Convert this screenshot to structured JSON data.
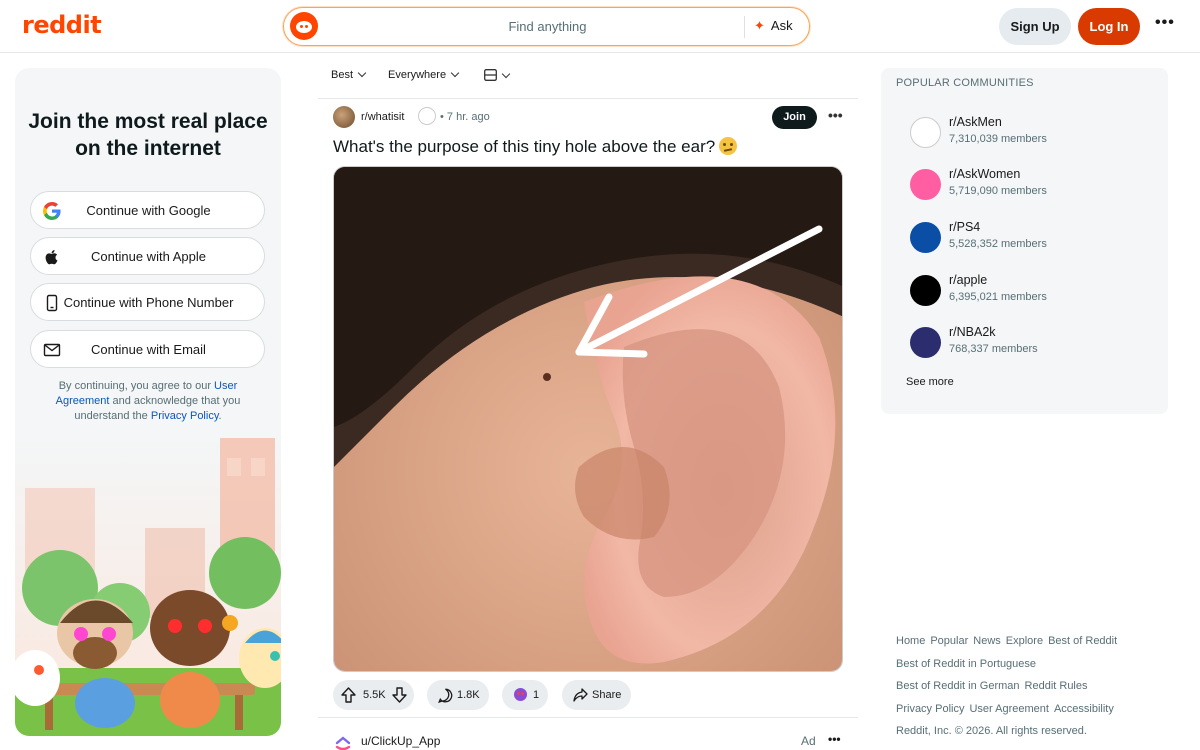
{
  "header": {
    "logo": "reddit",
    "search_placeholder": "Find anything",
    "ask_label": "Ask",
    "signup_label": "Sign Up",
    "login_label": "Log In",
    "more_label": "•••"
  },
  "left_panel": {
    "title": "Join the most real place on the internet",
    "buttons": [
      {
        "label": "Continue with Google",
        "icon": "google-icon"
      },
      {
        "label": "Continue with Apple",
        "icon": "apple-icon"
      },
      {
        "label": "Continue with Phone Number",
        "icon": "phone-icon"
      },
      {
        "label": "Continue with Email",
        "icon": "email-icon"
      }
    ],
    "legal_prefix": "By continuing, you agree to our ",
    "legal_link1": "User Agreement",
    "legal_middle": " and acknowledge that you understand the ",
    "legal_link2": "Privacy Policy",
    "legal_suffix": "."
  },
  "feed": {
    "sort": "Best",
    "scope": "Everywhere",
    "view_icon": "layout-icon",
    "post": {
      "subreddit": "r/whatisit",
      "time": "• 7 hr. ago",
      "join_label": "Join",
      "more_label": "•••",
      "title": "What's the purpose of this tiny hole above the ear?",
      "votes": "5.5K",
      "comments": "1.8K",
      "awards": "1",
      "share_label": "Share"
    },
    "ad": {
      "user": "u/ClickUp_App",
      "label": "Ad",
      "more_label": "•••"
    }
  },
  "sidebar": {
    "title": "POPULAR COMMUNITIES",
    "communities": [
      {
        "name": "r/AskMen",
        "members": "7,310,039 members"
      },
      {
        "name": "r/AskWomen",
        "members": "5,719,090 members"
      },
      {
        "name": "r/PS4",
        "members": "5,528,352 members"
      },
      {
        "name": "r/apple",
        "members": "6,395,021 members"
      },
      {
        "name": "r/NBA2k",
        "members": "768,337 members"
      }
    ],
    "see_more": "See more"
  },
  "footer": {
    "links_row1": [
      "Home",
      "Popular",
      "News",
      "Explore",
      "Best of Reddit"
    ],
    "link_row2": "Best of Reddit in Portuguese",
    "links_row3": [
      "Best of Reddit in German",
      "Reddit Rules"
    ],
    "links_row4": [
      "Privacy Policy",
      "User Agreement",
      "Accessibility"
    ],
    "copyright": "Reddit, Inc. © 2026. All rights reserved."
  }
}
